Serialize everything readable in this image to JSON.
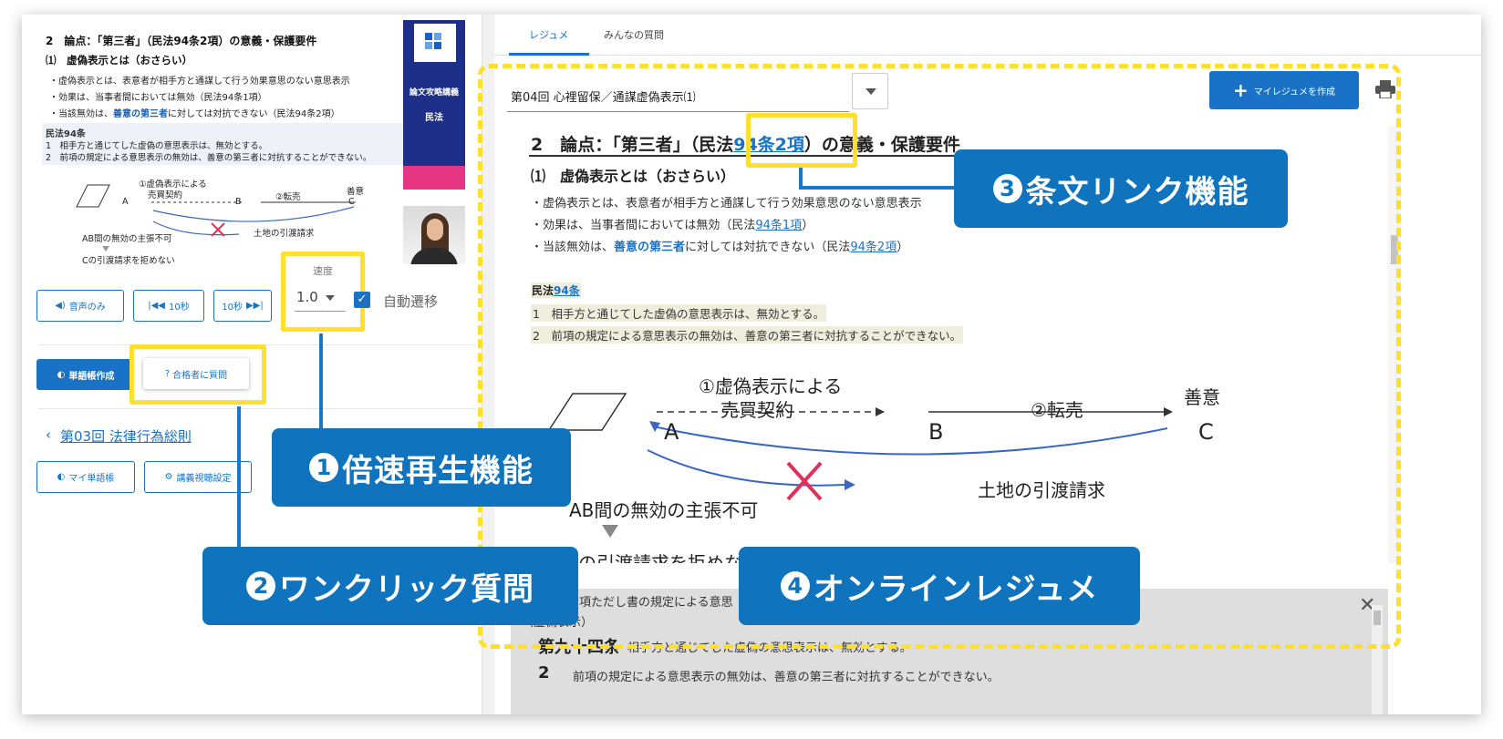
{
  "slide": {
    "heading": "2　論点：「第三者」（民法94条2項）の意義・保護要件",
    "subheading": "⑴　虚偽表示とは（おさらい）",
    "line1": "・虚偽表示とは、表意者が相手方と通謀して行う効果意思のない意思表示",
    "line2": "・効果は、当事者間においては無効（民法94条1項）",
    "line3_a": "・当該無効は、",
    "line3_b": "善意の第三者",
    "line3_c": "に対しては対抗できない（民法94条2項）",
    "law_title": "民法94条",
    "law_1": "1　相手方と通じてした虚偽の意思表示は、無効とする。",
    "law_2": "2　前項の規定による意思表示の無効は、善意の第三者に対抗することができない。",
    "d_contract1": "①虚偽表示による",
    "d_contract2": "売買契約",
    "d_resale": "②転売",
    "d_good": "善意",
    "d_a": "A",
    "d_b": "B",
    "d_c": "C",
    "d_claim": "土地の引渡請求",
    "d_invalid": "AB間の無効の主張不可",
    "d_refuse": "Cの引渡請求を拒めない",
    "banner_t1": "論文攻略講義",
    "banner_t2": "民法"
  },
  "controls": {
    "audio_only": "音声のみ",
    "back10": "10秒",
    "fwd10": "10秒",
    "speed_label": "速度",
    "speed_value": "1.0",
    "auto_label": "自動遷移",
    "vocab_create": "単語帳作成",
    "ask_passer": "合格者に質問",
    "prev_lecture": "第03回 法律行為総則",
    "my_vocab": "マイ単語帳",
    "lecture_settings": "講義視聴設定"
  },
  "resume": {
    "tab_resume": "レジュメ",
    "tab_questions": "みんなの質問",
    "lecture_select": "第04回 心裡留保／通謀虚偽表示⑴",
    "my_resume_button": "マイレジュメを作成",
    "h2_a": "2　論点：「第三者」（民法",
    "h2_link": "94条2項",
    "h2_b": "）の意義・保護要件",
    "h3": "⑴　虚偽表示とは（おさらい）",
    "p1": "・虚偽表示とは、表意者が相手方と通謀して行う効果意思のない意思表示",
    "p2_a": "・効果は、当事者間においては無効（民法",
    "p2_link": "94条1項",
    "p2_b": "）",
    "p3_a": "・当該無効は、",
    "p3_em": "善意の第三者",
    "p3_b": "に対しては対抗できない（民法",
    "p3_link": "94条2項",
    "p3_c": "）",
    "law_a": "民法",
    "law_link": "94条",
    "law_1": "1　相手方と通じてした虚偽の意思表示は、無効とする。",
    "law_2": "2　前項の規定による意思表示の無効は、善意の第三者に対抗することができない。",
    "d_contract1": "①虚偽表示による",
    "d_contract2": "売買契約",
    "d_resale": "②転売",
    "d_good": "善意",
    "d_a": "A",
    "d_b": "B",
    "d_c": "C",
    "d_claim": "土地の引渡請求",
    "d_invalid": "AB間の無効の主張不可",
    "d_refuse": "Cの引渡請求を拒めない"
  },
  "popup": {
    "line1": "前項ただし書の規定による意思",
    "line2": "（虚偽表示）",
    "article": "第九十四条",
    "art_text": "相手方と通じてした虚偽の意思表示は、無効とする。",
    "num2": "2",
    "art_text2": "前項の規定による意思表示の無効は、善意の第三者に対抗することができない。"
  },
  "callouts": {
    "c1_num": "1",
    "c1_text": "倍速再生機能",
    "c2_num": "2",
    "c2_text": "ワンクリック質問",
    "c3_num": "3",
    "c3_text": "条文リンク機能",
    "c4_num": "4",
    "c4_text": "オンラインレジュメ"
  },
  "colors": {
    "accent_blue": "#1a72c6",
    "callout_blue": "#0f74bd",
    "highlight_yellow": "#ffdf2e",
    "banner_navy": "#1d2f88",
    "banner_pink": "#e63582",
    "cross_red": "#e0315a"
  },
  "icons": [
    "speaker-icon",
    "rewind-icon",
    "forward-icon",
    "dropdown-caret-icon",
    "checkbox-icon",
    "vocab-icon",
    "question-icon",
    "chevron-left-icon",
    "gear-icon",
    "plus-icon",
    "printer-icon",
    "close-icon"
  ]
}
